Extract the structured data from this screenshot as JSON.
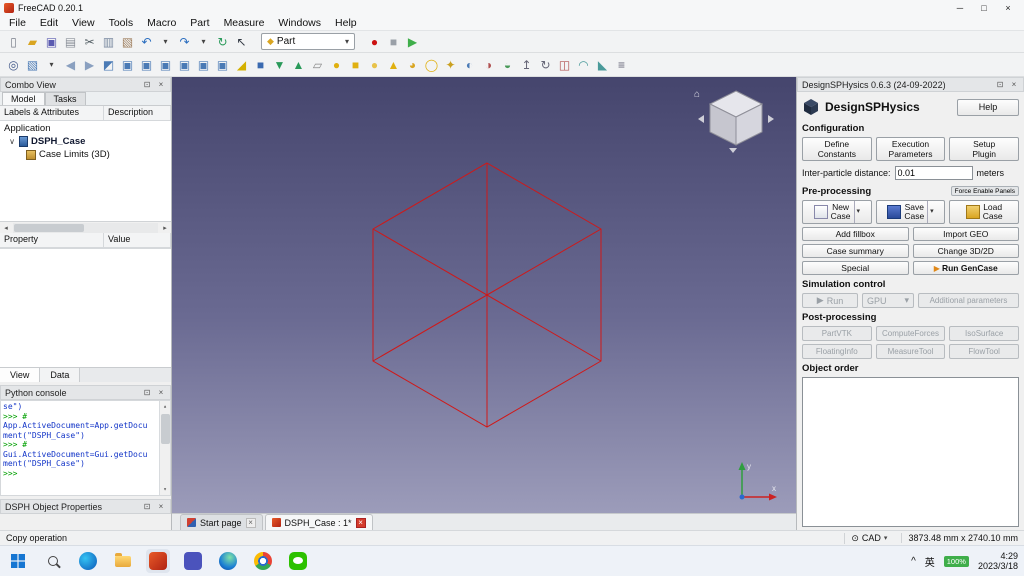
{
  "window": {
    "title": "FreeCAD 0.20.1",
    "minimize": "─",
    "maximize": "□",
    "close": "×"
  },
  "icons": {
    "caret": "▾",
    "close": "×",
    "float": "⊡",
    "expander": "∨",
    "play": "▶",
    "scroll_left": "◂",
    "scroll_right": "▸",
    "scroll_up": "▴",
    "scroll_down": "▾",
    "home": "⌂",
    "nav_marker": "⊙"
  },
  "menubar": [
    "File",
    "Edit",
    "View",
    "Tools",
    "Macro",
    "Part",
    "Measure",
    "Windows",
    "Help"
  ],
  "toolbar1": {
    "workbench": "Part",
    "workbench_icon": "◆",
    "workbench_caret": "▾",
    "groupA": [
      {
        "name": "new-file-icon",
        "g": "▯",
        "st": "color:#7a7f8a"
      },
      {
        "name": "open-file-icon",
        "g": "▰",
        "st": "color:#d9a521"
      },
      {
        "name": "save-file-icon",
        "g": "▣",
        "st": "color:#5a5ab0"
      },
      {
        "name": "print-icon",
        "g": "▤",
        "st": "color:#8a8f98"
      },
      {
        "name": "cut-icon",
        "g": "✂",
        "st": "color:#556066"
      },
      {
        "name": "copy-icon",
        "g": "▥",
        "st": "color:#7a8aa0"
      },
      {
        "name": "paste-icon",
        "g": "▧",
        "st": "color:#a08060"
      },
      {
        "name": "undo-icon",
        "g": "↶",
        "st": "color:#2a6dbf"
      },
      {
        "name": "undo-dropdown-icon",
        "g": "▾",
        "st": "color:#444;font-size:8px"
      },
      {
        "name": "redo-icon",
        "g": "↷",
        "st": "color:#2a6dbf"
      },
      {
        "name": "redo-dropdown-icon",
        "g": "▾",
        "st": "color:#444;font-size:8px"
      },
      {
        "name": "refresh-icon",
        "g": "↻",
        "st": "color:#2a9a5a"
      },
      {
        "name": "whats-this-icon",
        "g": "↖",
        "st": "color:#333a44"
      }
    ],
    "groupB": [
      {
        "name": "macro-record-icon",
        "g": "●",
        "st": "color:#cc1111"
      },
      {
        "name": "macro-stop-icon",
        "g": "■",
        "st": "color:#9aa0a8"
      },
      {
        "name": "macro-play-icon",
        "g": "▶",
        "st": "color:#3fae4a"
      }
    ]
  },
  "toolbar2": [
    {
      "name": "fit-all-icon",
      "g": "◎",
      "st": "color:#445a8a"
    },
    {
      "name": "draw-style-icon",
      "g": "▧",
      "st": "color:#4a7ab5"
    },
    {
      "name": "draw-style-dropdown-icon",
      "g": "▾",
      "st": "color:#444;font-size:8px"
    },
    {
      "name": "view-back-icon",
      "g": "◀",
      "st": "color:#8aa0c0"
    },
    {
      "name": "view-forward-icon",
      "g": "▶",
      "st": "color:#8aa0c0"
    },
    {
      "name": "view-isometric-icon",
      "g": "◩",
      "st": "color:#4a7ab5"
    },
    {
      "name": "view-front-icon",
      "g": "▣",
      "st": "color:#4a7ab5"
    },
    {
      "name": "view-top-icon",
      "g": "▣",
      "st": "color:#4a7ab5"
    },
    {
      "name": "view-right-icon",
      "g": "▣",
      "st": "color:#4a7ab5"
    },
    {
      "name": "view-rear-icon",
      "g": "▣",
      "st": "color:#4a7ab5"
    },
    {
      "name": "view-bottom-icon",
      "g": "▣",
      "st": "color:#4a7ab5"
    },
    {
      "name": "view-left-icon",
      "g": "▣",
      "st": "color:#4a7ab5"
    },
    {
      "name": "measure-distance-icon",
      "g": "◢",
      "st": "color:#d4b000"
    },
    {
      "name": "part-box-icon",
      "g": "■",
      "st": "color:#3a6ab0"
    },
    {
      "name": "part-import-icon",
      "g": "▼",
      "st": "color:#2a9a5a"
    },
    {
      "name": "part-export-icon",
      "g": "▲",
      "st": "color:#2a9a5a"
    },
    {
      "name": "shape-builder-icon",
      "g": "▱",
      "st": "color:#888"
    },
    {
      "name": "prim-cylinder-icon",
      "g": "●",
      "st": "color:#e0b010"
    },
    {
      "name": "prim-box-icon",
      "g": "■",
      "st": "color:#e0b010"
    },
    {
      "name": "prim-sphere-icon",
      "g": "●",
      "st": "color:#e8c24a"
    },
    {
      "name": "prim-cone-icon",
      "g": "▲",
      "st": "color:#e0b010"
    },
    {
      "name": "prim-ellipsoid-icon",
      "g": "◕",
      "st": "color:#d9a521"
    },
    {
      "name": "prim-torus-icon",
      "g": "◯",
      "st": "color:#e0b010"
    },
    {
      "name": "prim-shapes-icon",
      "g": "✦",
      "st": "color:#caa020"
    },
    {
      "name": "bool-union-icon",
      "g": "◐",
      "st": "color:#4a7ab5"
    },
    {
      "name": "bool-cut-icon",
      "g": "◑",
      "st": "color:#b05050"
    },
    {
      "name": "bool-common-icon",
      "g": "◒",
      "st": "color:#4a9a5a"
    },
    {
      "name": "extrude-icon",
      "g": "↥",
      "st": "color:#667"
    },
    {
      "name": "revolve-icon",
      "g": "↻",
      "st": "color:#667"
    },
    {
      "name": "mirror-icon",
      "g": "◫",
      "st": "color:#b05050"
    },
    {
      "name": "fillet-icon",
      "g": "◠",
      "st": "color:#4a9a9a"
    },
    {
      "name": "section-icon",
      "g": "◣",
      "st": "color:#4a9a9a"
    },
    {
      "name": "offset-icon",
      "g": "≡",
      "st": "color:#667"
    }
  ],
  "combo_view": {
    "title": "Combo View",
    "tab_model": "Model",
    "tab_tasks": "Tasks",
    "col_labels": "Labels & Attributes",
    "col_description": "Description",
    "tree_root": "Application",
    "tree_items": [
      {
        "label": "DSPH_Case"
      },
      {
        "label": "Case Limits (3D)"
      }
    ],
    "col_property": "Property",
    "col_value": "Value",
    "tab_view": "View",
    "tab_data": "Data"
  },
  "python_console": {
    "title": "Python console",
    "lines": [
      {
        "text": "se\")",
        "color": "blue"
      },
      {
        "text": ">>> #",
        "color": "green"
      },
      {
        "text": "App.ActiveDocument=App.getDocu",
        "color": "blue"
      },
      {
        "text": "ment(\"DSPH_Case\")",
        "color": "blue"
      },
      {
        "text": ">>> #",
        "color": "green"
      },
      {
        "text": "Gui.ActiveDocument=Gui.getDocu",
        "color": "blue"
      },
      {
        "text": "ment(\"DSPH_Case\")",
        "color": "blue"
      },
      {
        "text": ">>>",
        "color": "green"
      }
    ]
  },
  "dsph_properties_title": "DSPH Object Properties",
  "viewport": {
    "tabs": [
      {
        "label": "Start page"
      },
      {
        "label": "DSPH_Case : 1*"
      }
    ],
    "axis_x": "x",
    "axis_y": "y"
  },
  "dsph_panel": {
    "title": "DesignSPHysics 0.6.3 (24-09-2022)",
    "brand": "DesignSPHysics",
    "help_button": "Help",
    "configuration_label": "Configuration",
    "define_constants": "Define\nConstants",
    "execution_parameters": "Execution\nParameters",
    "setup_plugin": "Setup\nPlugin",
    "interparticle_label": "Inter-particle distance:",
    "interparticle_value": "0.01",
    "interparticle_unit": "meters",
    "preprocessing_label": "Pre-processing",
    "force_enable_panels": "Force Enable Panels",
    "new_case": "New\nCase",
    "save_case": "Save\nCase",
    "load_case": "Load\nCase",
    "add_fillbox": "Add fillbox",
    "import_geo": "Import GEO",
    "case_summary": "Case summary",
    "change_3d_2d": "Change 3D/2D",
    "special": "Special",
    "run_gencase": "Run GenCase",
    "simulation_label": "Simulation control",
    "run": "Run",
    "gpu": "GPU",
    "additional_parameters": "Additional parameters",
    "postprocessing_label": "Post-processing",
    "post_buttons": [
      "PartVTK",
      "ComputeForces",
      "IsoSurface",
      "FloatingInfo",
      "MeasureTool",
      "FlowTool"
    ],
    "object_order_label": "Object order"
  },
  "status_bar": {
    "message": "Copy operation",
    "nav_style": "CAD",
    "dimensions": "3873.48 mm x 2740.10 mm"
  },
  "taskbar": {
    "tray": {
      "chevron": "^",
      "ime": "英",
      "battery": "100%",
      "time": "4:29",
      "date": "2023/3/18"
    }
  }
}
